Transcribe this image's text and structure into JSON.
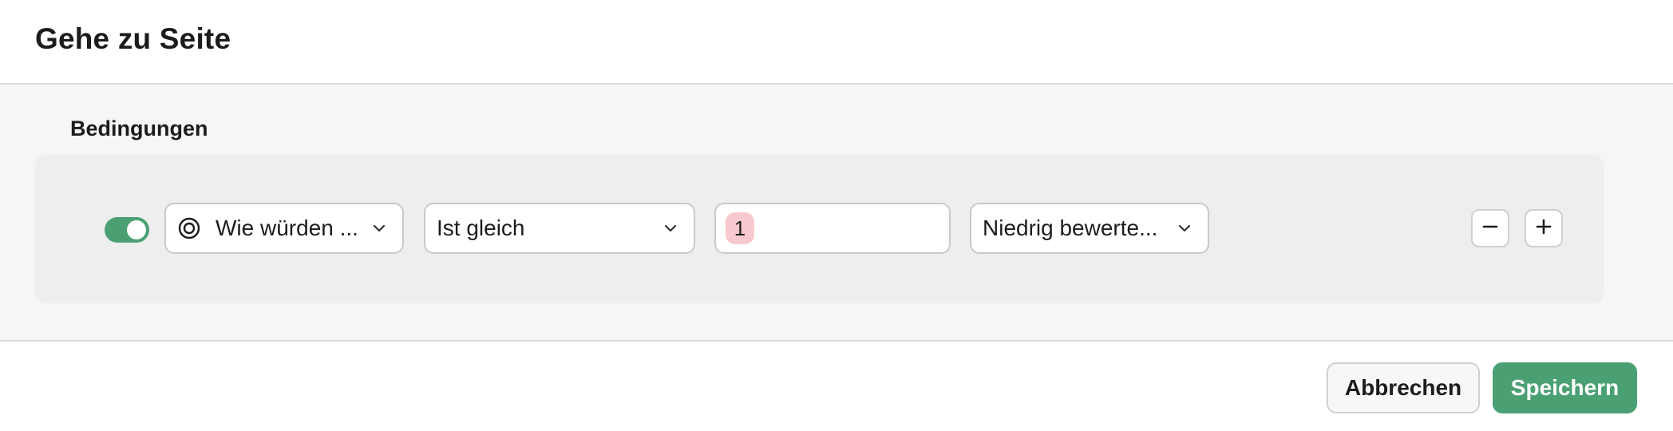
{
  "dialog": {
    "title": "Gehe zu Seite"
  },
  "conditions": {
    "section_title": "Bedingungen",
    "rule": {
      "enabled": true,
      "question": "Wie würden ...",
      "operator": "Ist gleich",
      "value": "1",
      "target": "Niedrig bewerte..."
    }
  },
  "footer": {
    "cancel_label": "Abbrechen",
    "save_label": "Speichern"
  },
  "colors": {
    "accent": "#4aa073",
    "value_chip": "#f8c9cf"
  }
}
